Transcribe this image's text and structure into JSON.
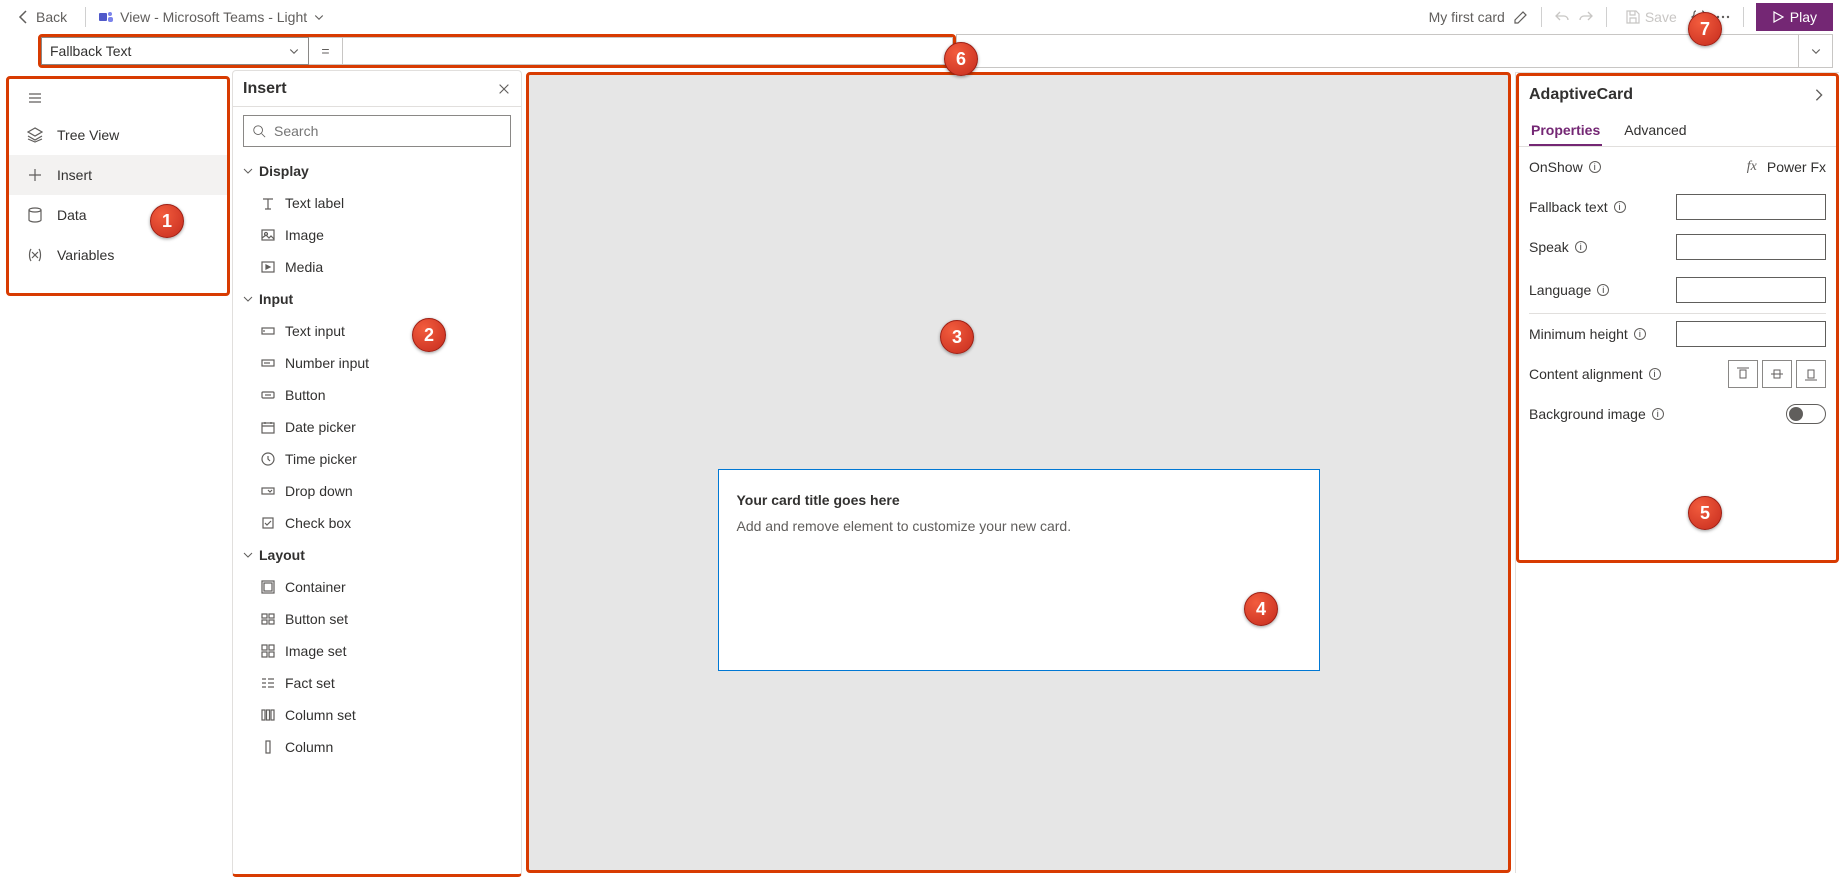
{
  "header": {
    "back": "Back",
    "view_label": "View - Microsoft Teams - Light",
    "card_name": "My first card",
    "save": "Save",
    "play": "Play"
  },
  "formula": {
    "property": "Fallback Text",
    "equals": "=",
    "value": ""
  },
  "rail": {
    "items": [
      "Tree View",
      "Insert",
      "Data",
      "Variables"
    ],
    "selected": 1
  },
  "insert": {
    "title": "Insert",
    "search_placeholder": "Search",
    "groups": [
      {
        "name": "Display",
        "items": [
          "Text label",
          "Image",
          "Media"
        ]
      },
      {
        "name": "Input",
        "items": [
          "Text input",
          "Number input",
          "Button",
          "Date picker",
          "Time picker",
          "Drop down",
          "Check box"
        ]
      },
      {
        "name": "Layout",
        "items": [
          "Container",
          "Button set",
          "Image set",
          "Fact set",
          "Column set",
          "Column"
        ]
      }
    ]
  },
  "card": {
    "title": "Your card title goes here",
    "subtitle": "Add and remove element to customize your new card."
  },
  "props": {
    "title": "AdaptiveCard",
    "tabs": [
      "Properties",
      "Advanced"
    ],
    "active_tab": 0,
    "onshow": "OnShow",
    "powerfx": "Power Fx",
    "rows": {
      "fallback": "Fallback text",
      "speak": "Speak",
      "language": "Language",
      "minheight": "Minimum height",
      "alignment": "Content alignment",
      "bgimage": "Background image"
    }
  },
  "badges": [
    "1",
    "2",
    "3",
    "4",
    "5",
    "6",
    "7"
  ]
}
